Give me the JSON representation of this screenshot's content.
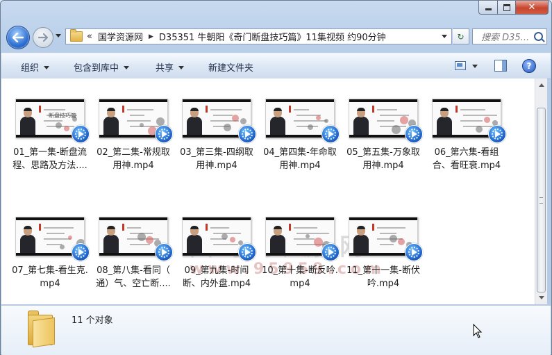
{
  "window": {
    "buttons": {
      "minimize": "minimize",
      "maximize": "maximize",
      "close": "✕"
    }
  },
  "address": {
    "overflow": "«",
    "crumbs": [
      "国学资源网",
      "D35351 牛朝阳《奇门断盘技巧篇》11集视频 约90分钟"
    ],
    "search_placeholder": "搜索 D35..."
  },
  "toolbar": {
    "organize": "组织",
    "include_library": "包含到库中",
    "share": "共享",
    "new_folder": "新建文件夹",
    "help": "?"
  },
  "files": [
    {
      "name": "01_第一集-断盘流\n程、思路及方法....",
      "slide_title": "断盘技巧篇"
    },
    {
      "name": "02_第二集-常规取\n用神.mp4",
      "slide_title": ""
    },
    {
      "name": "03_第三集-四纲取\n用神.mp4",
      "slide_title": ""
    },
    {
      "name": "04_第四集-年命取\n用神.mp4",
      "slide_title": ""
    },
    {
      "name": "05_第五集-万象取\n用神.mp4",
      "slide_title": ""
    },
    {
      "name": "06_第六集-看组\n合、看旺衰.mp4",
      "slide_title": ""
    },
    {
      "name": "07_第七集-看生克.\nmp4",
      "slide_title": ""
    },
    {
      "name": "08_第八集-看同（\n通）气、空亡断....",
      "slide_title": ""
    },
    {
      "name": "09_第九集-时间\n断、内外盘.mp4",
      "slide_title": ""
    },
    {
      "name": "10_第十集-断反吟.\nmp4",
      "slide_title": ""
    },
    {
      "name": "11_第十一集-断伏\n吟.mp4",
      "slide_title": ""
    }
  ],
  "watermark": {
    "line1": "国学资源网",
    "line2": "www.95959.com"
  },
  "status": {
    "count": "11 个对象"
  },
  "colors": {
    "accent": "#2c6fd1",
    "close": "#c7452f",
    "badge": "#1f63c9"
  }
}
